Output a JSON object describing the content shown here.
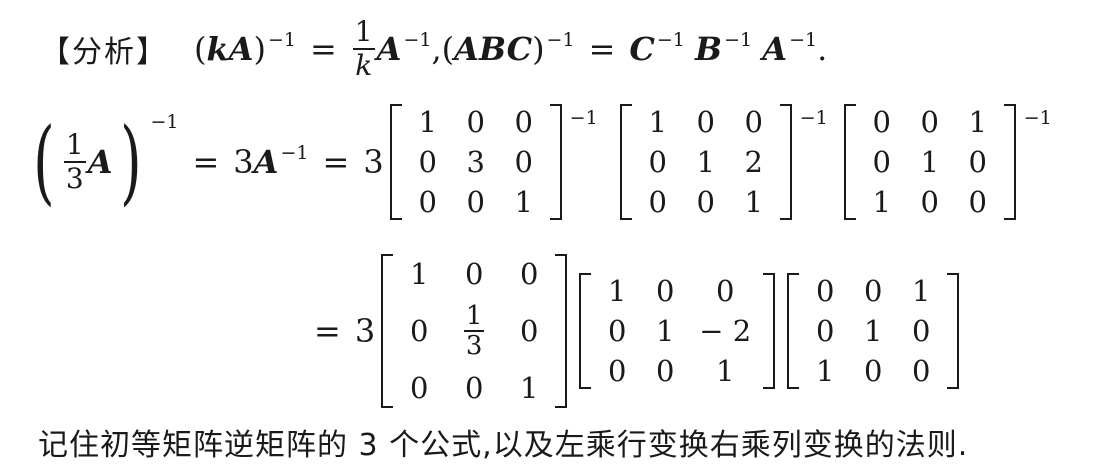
{
  "header_tag": "【分析】",
  "formula1": {
    "lhs_k": "k",
    "lhs_A": "A",
    "inv": "−1",
    "frac_num": "1",
    "frac_den": "k",
    "rhs_A": "A",
    "sep": ",",
    "abc": "ABC",
    "C": "C",
    "B": "B",
    "A": "A",
    "period": "."
  },
  "line2": {
    "frac_num": "1",
    "frac_den": "3",
    "A": "A",
    "inv": "−1",
    "three_A": "3",
    "A2": "A",
    "coef": "3",
    "m1": [
      "1",
      "0",
      "0",
      "0",
      "3",
      "0",
      "0",
      "0",
      "1"
    ],
    "m2": [
      "1",
      "0",
      "0",
      "0",
      "1",
      "2",
      "0",
      "0",
      "1"
    ],
    "m3": [
      "0",
      "0",
      "1",
      "0",
      "1",
      "0",
      "1",
      "0",
      "0"
    ]
  },
  "line3": {
    "coef": "3",
    "m1": [
      "1",
      "0",
      "0",
      "0",
      "",
      "0",
      "0",
      "0",
      "1"
    ],
    "m1_frac_num": "1",
    "m1_frac_den": "3",
    "m2": [
      "1",
      "0",
      "0",
      "0",
      "1",
      "− 2",
      "0",
      "0",
      "1"
    ],
    "m3": [
      "0",
      "0",
      "1",
      "0",
      "1",
      "0",
      "1",
      "0",
      "0"
    ]
  },
  "note": "记住初等矩阵逆矩阵的 3 个公式,以及左乘行变换右乘列变换的法则."
}
